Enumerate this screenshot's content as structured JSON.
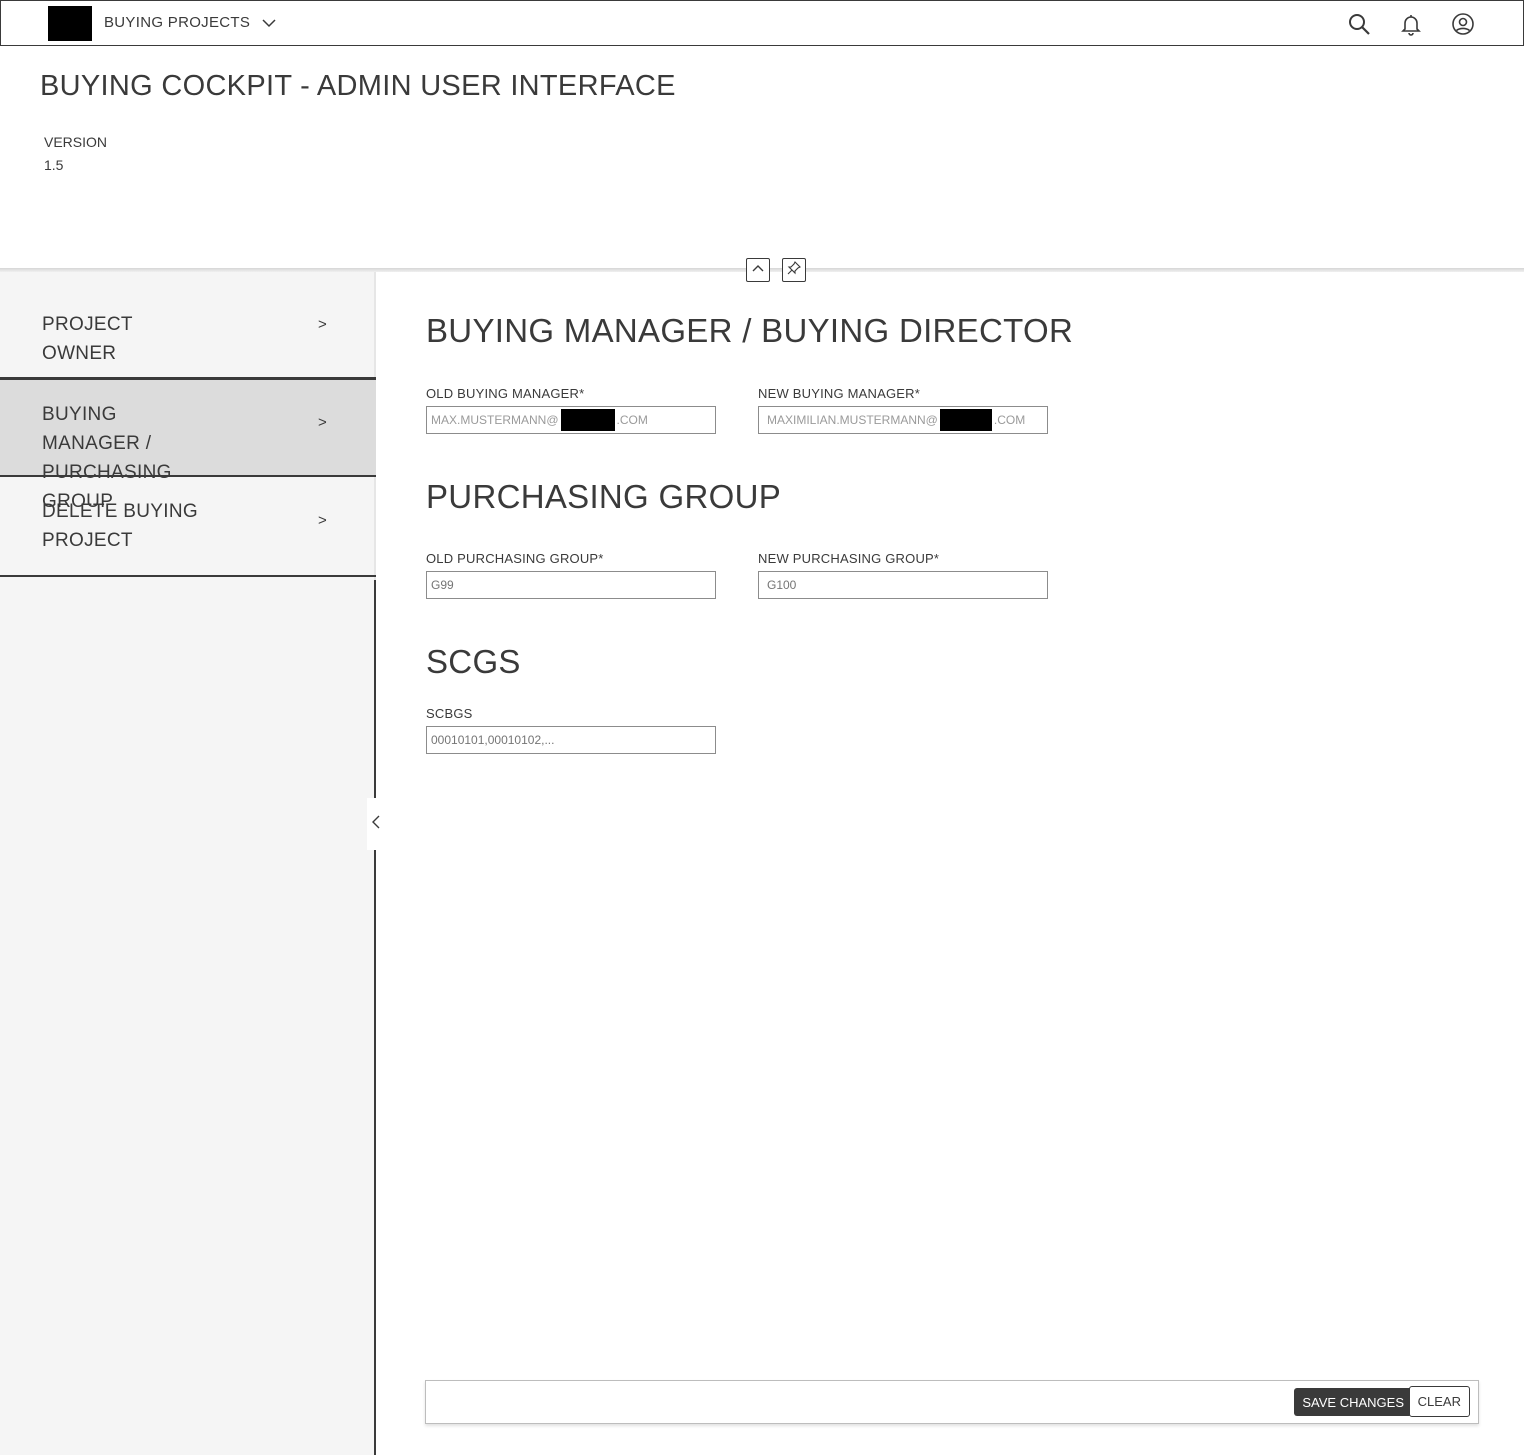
{
  "shellbar": {
    "app_name": "BUYING PROJECTS",
    "icons": [
      "search-icon",
      "bell-icon",
      "user-circle-icon"
    ]
  },
  "header": {
    "title": "BUYING COCKPIT - ADMIN USER INTERFACE",
    "version_label": "VERSION",
    "version_value": "1.5"
  },
  "sidebar": {
    "items": [
      {
        "label": "PROJECT OWNER",
        "arrow": ">"
      },
      {
        "label": "BUYING MANAGER / PURCHASING GROUP",
        "arrow": ">"
      },
      {
        "label": "DELETE BUYING PROJECT",
        "arrow": ">"
      }
    ],
    "active_index": 1
  },
  "sections": {
    "buying_manager": {
      "title": "BUYING MANAGER / BUYING DIRECTOR",
      "old_label": "OLD BUYING MANAGER*",
      "old_placeholder_pre": "MAX.MUSTERMANN@",
      "old_placeholder_post": ".COM",
      "new_label": "NEW BUYING MANAGER*",
      "new_placeholder_pre": "MAXIMILIAN.MUSTERMANN@",
      "new_placeholder_post": ".COM"
    },
    "purchasing_group": {
      "title": "PURCHASING GROUP",
      "old_label": "OLD PURCHASING GROUP*",
      "old_placeholder": "G99",
      "new_label": "NEW PURCHASING GROUP*",
      "new_placeholder": "G100"
    },
    "scgs": {
      "title": "SCGS",
      "label": "SCBGS",
      "placeholder": "00010101,00010102,..."
    }
  },
  "footer": {
    "save_label": "SAVE CHANGES",
    "clear_label": "CLEAR"
  }
}
